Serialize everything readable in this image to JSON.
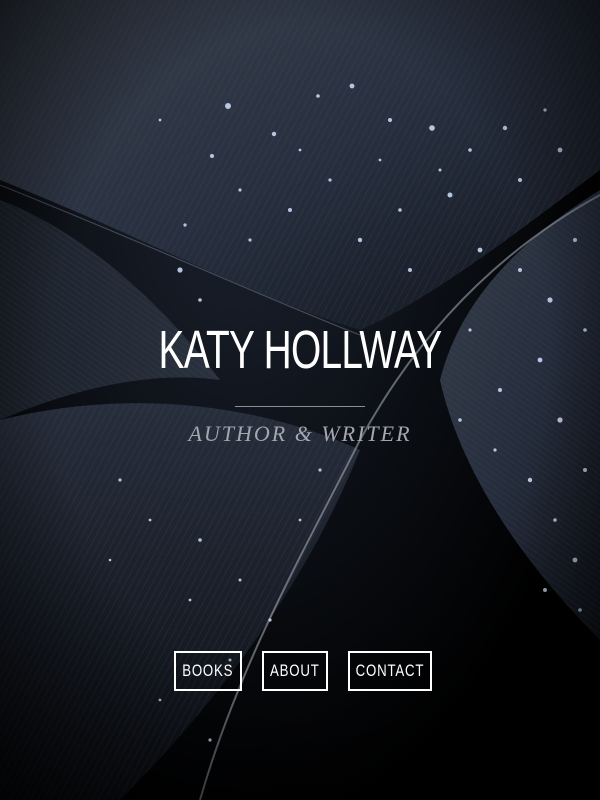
{
  "site": {
    "author_name": "KATY HOLLWAY",
    "tagline": "AUTHOR & WRITER"
  },
  "nav": {
    "books_label": "BOOKS",
    "about_label": "ABOUT",
    "contact_label": "CONTACT"
  },
  "colors": {
    "background": "#000000",
    "text": "#ffffff",
    "tagline": "#a3a8ae",
    "divider": "#8a8f96"
  },
  "background_image": {
    "icon": "feather-with-water-droplets-photo"
  }
}
